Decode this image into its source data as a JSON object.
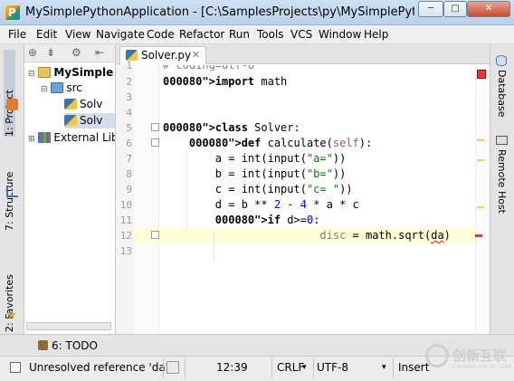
{
  "window": {
    "title": "MySimplePythonApplication - [C:\\SamplesProjects\\py\\MySimplePythonApplicat...",
    "minimize_label": "─",
    "maximize_label": "□",
    "close_label": "✕"
  },
  "menu": [
    "File",
    "Edit",
    "View",
    "Navigate",
    "Code",
    "Refactor",
    "Run",
    "Tools",
    "VCS",
    "Window",
    "Help"
  ],
  "left_stripe": {
    "project_tab": "1: Project",
    "structure_tab": "7: Structure",
    "favorites_tab": "2: Favorites"
  },
  "project_tree": [
    {
      "label": "MySimple",
      "icon": "folder-icon",
      "bold": true
    },
    {
      "label": "src",
      "icon": "source-folder-icon"
    },
    {
      "label": "Solv",
      "icon": "python-file-icon"
    },
    {
      "label": "Solv",
      "icon": "python-file-icon"
    },
    {
      "label": "External Libr",
      "icon": "library-icon"
    }
  ],
  "editor": {
    "tab_label": "Solver.py",
    "lines": [
      {
        "num": "1",
        "text": "# coding=utf-8"
      },
      {
        "num": "2",
        "text": "import math"
      },
      {
        "num": "3",
        "text": ""
      },
      {
        "num": "4",
        "text": ""
      },
      {
        "num": "5",
        "text": "class Solver:"
      },
      {
        "num": "6",
        "text": "    def calculate(self):"
      },
      {
        "num": "7",
        "text": "        a = int(input(\"a=\"))"
      },
      {
        "num": "8",
        "text": "        b = int(input(\"b=\"))"
      },
      {
        "num": "9",
        "text": "        c = int(input(\"c= \"))"
      },
      {
        "num": "10",
        "text": "        d = b ** 2 - 4 * a * c"
      },
      {
        "num": "11",
        "text": "        if d>=0:"
      },
      {
        "num": "12",
        "text": "                        disc = math.sqrt(da)"
      },
      {
        "num": "13",
        "text": ""
      }
    ]
  },
  "right_stripe": {
    "database_tab": "Database",
    "remote_host_tab": "Remote Host"
  },
  "bottom_tools": {
    "todo_label": "6: TODO"
  },
  "status_bar": {
    "message": "Unresolved reference 'da'",
    "position": "12:39",
    "line_separator": "CRLF",
    "encoding": "UTF-8",
    "mode": "Insert"
  },
  "watermark": {
    "text": "创新互联",
    "sub": "CHUANG XIN HU LIAN"
  },
  "colors": {
    "keyword": "#000080",
    "string": "#008000",
    "self": "#94558d",
    "number": "#0000ff",
    "current_line": "#ffffd7",
    "error": "#e53935"
  }
}
